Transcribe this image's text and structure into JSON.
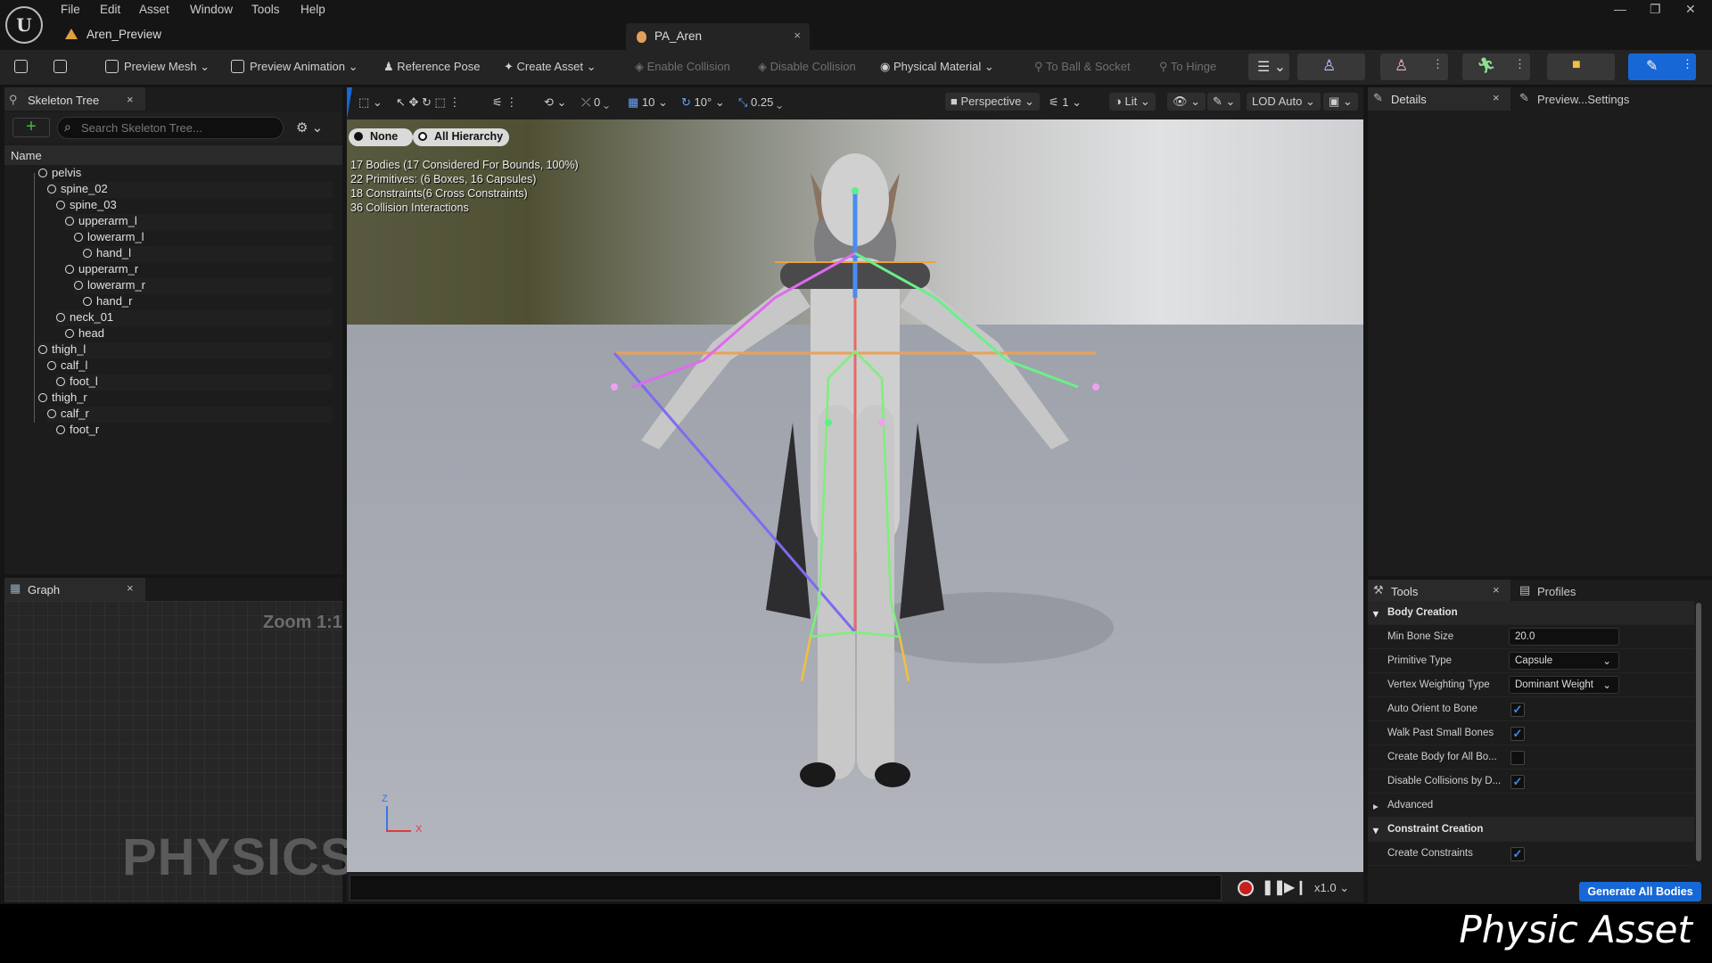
{
  "menu": {
    "items": [
      "File",
      "Edit",
      "Asset",
      "Window",
      "Tools",
      "Help"
    ],
    "asset_name": "Aren_Preview"
  },
  "document_tab": {
    "title": "PA_Aren",
    "close": "×"
  },
  "toolbar": {
    "preview_mesh": "Preview Mesh",
    "preview_animation": "Preview Animation",
    "reference_pose": "Reference Pose",
    "create_asset": "Create Asset",
    "enable_collision": "Enable Collision",
    "disable_collision": "Disable Collision",
    "physical_material": "Physical Material",
    "to_ball_socket": "To Ball & Socket",
    "to_hinge": "To Hinge"
  },
  "skeleton": {
    "tab": "Skeleton Tree",
    "search_placeholder": "Search Skeleton Tree...",
    "column": "Name",
    "bones": [
      "pelvis",
      "spine_02",
      "spine_03",
      "upperarm_l",
      "lowerarm_l",
      "hand_l",
      "upperarm_r",
      "lowerarm_r",
      "hand_r",
      "neck_01",
      "head",
      "thigh_l",
      "calf_l",
      "foot_l",
      "thigh_r",
      "calf_r",
      "foot_r"
    ]
  },
  "graph": {
    "tab": "Graph",
    "zoom": "Zoom 1:1",
    "watermark": "PHYSICS"
  },
  "viewport": {
    "grid": "10",
    "angle": "10°",
    "scale": "0.25",
    "rot_val": "0",
    "view": "Perspective",
    "layer": "1",
    "lit": "Lit",
    "lod": "LOD Auto",
    "filter_none": "None",
    "filter_all": "All Hierarchy",
    "stats": [
      "17 Bodies (17 Considered For Bounds, 100%)",
      "22 Primitives: (6 Boxes, 16 Capsules)",
      "18 Constraints(6 Cross Constraints)",
      "36 Collision Interactions"
    ],
    "axis_z": "Z",
    "axis_x": "X",
    "speed": "x1.0"
  },
  "details": {
    "tab1": "Details",
    "tab2": "Preview...Settings"
  },
  "tools": {
    "tab1": "Tools",
    "tab2": "Profiles",
    "body_creation": "Body Creation",
    "min_bone_size_label": "Min Bone Size",
    "min_bone_size": "20.0",
    "primitive_type_label": "Primitive Type",
    "primitive_type": "Capsule",
    "vertex_weighting_label": "Vertex Weighting Type",
    "vertex_weighting": "Dominant Weight",
    "auto_orient": "Auto Orient to Bone",
    "walk_past": "Walk Past Small Bones",
    "create_body_all": "Create Body for All Bo...",
    "disable_collisions": "Disable Collisions by D...",
    "advanced": "Advanced",
    "constraint_creation": "Constraint Creation",
    "create_constraints": "Create Constraints",
    "generate": "Generate All Bodies"
  },
  "caption": "Physic Asset",
  "colors": {
    "accent": "#1768d6",
    "record": "#c81e1e"
  }
}
